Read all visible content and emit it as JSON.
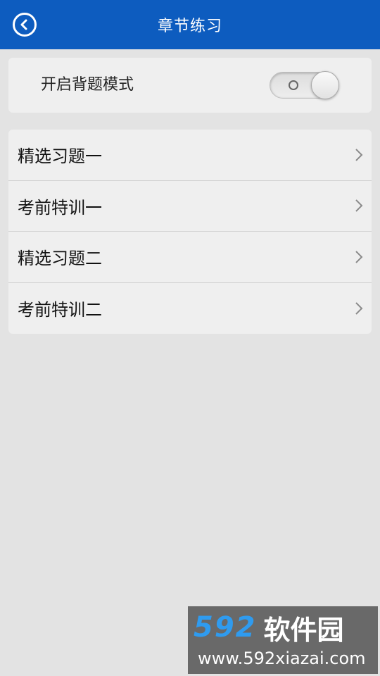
{
  "header": {
    "title": "章节练习",
    "back_icon": "back-circle-icon",
    "background": "#0d5cbf"
  },
  "toggle": {
    "label": "开启背题模式",
    "state": "off"
  },
  "list": {
    "items": [
      {
        "label": "精选习题一"
      },
      {
        "label": "考前特训一"
      },
      {
        "label": "精选习题二"
      },
      {
        "label": "考前特训二"
      }
    ]
  },
  "watermark": {
    "logo_number": "592",
    "logo_text": "软件园",
    "url": "www.592xiazai.com"
  }
}
